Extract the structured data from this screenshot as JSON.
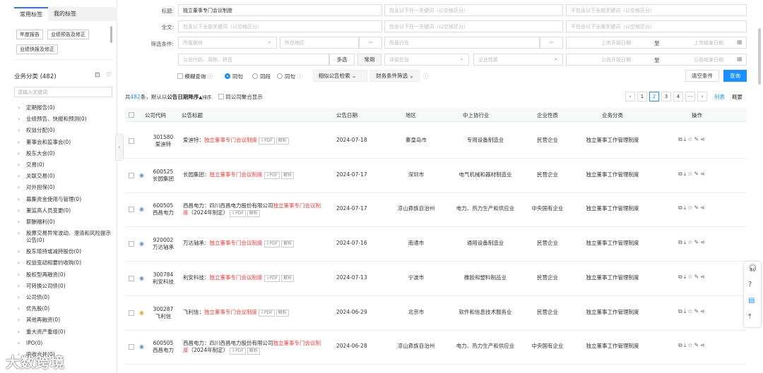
{
  "sidebar": {
    "tabs": [
      "常用标签",
      "我的标签"
    ],
    "chips": [
      "年度报告",
      "业绩预告及修正",
      "业绩快报及修正"
    ],
    "category_title": "业务分类 (482)",
    "keyword_placeholder": "请输入关键词",
    "tree": [
      "定期报告(0)",
      "业绩预告、快报和预测(0)",
      "权益分配(0)",
      "董事会和监事会(0)",
      "股东大会(0)",
      "交易(0)",
      "关联交易(0)",
      "对外担保(0)",
      "募集资金使用与管理(0)",
      "董监高人员变更(0)",
      "薪酬福利(0)",
      "股票交易异常波动、澄清和风险提示公告(0)",
      "股东增持或减持股份(0)",
      "权益变动和要约收购(0)",
      "股权型再融资(0)",
      "可转换公司债(0)",
      "公司债(0)",
      "优先股(0)",
      "其他再融资(0)",
      "重大资产重组(0)",
      "IPO(0)",
      "吸收合并(0)"
    ]
  },
  "filters": {
    "title_label": "标题:",
    "title_value": "独立董事专门会议制度",
    "title_any_ph": "包含以下任一关键词（以空格区分）",
    "title_none_ph": "不包含以下全部关键词（以空格区分）",
    "full_label": "全文:",
    "full_all_ph": "包含以下全部关键词（以空格区分）",
    "full_any_ph": "包含以下任一关键词（以空格区分）",
    "full_none_ph": "不包含以下全部关键词（以空格区分）",
    "cond_label": "筛选条件:",
    "market_ph": "所属板块",
    "region_ph": "所在地区",
    "industry_ph": "所属行业",
    "list_start_ph": "上市开始日期",
    "list_end_ph": "上市结束日期",
    "to": "至",
    "code_ph": "公司代码、简称、拼音",
    "multi_btn": "多选",
    "common_btn": "常用",
    "rating_ph": "评级信息",
    "nature_ph": "企业性质",
    "ann_start_ph": "公告开始日期",
    "ann_end_ph": "公告结束日期",
    "fuzzy": "模糊查询",
    "same_sentence": "同句",
    "same_para": "同段",
    "same_article": "同句",
    "similar_search": "相似公告检索",
    "finance_filter": "财务条件筛选",
    "clear_btn": "清空条件",
    "search_btn": "查询"
  },
  "summary": {
    "prefix": "共",
    "count": "482",
    "suffix": "条，默认以",
    "sort": "公告日期降序",
    "sort_icon": "▲排序",
    "merge": "同公司聚合显示"
  },
  "pager": [
    "‹",
    "1",
    "2",
    "3",
    "4",
    "···",
    "›"
  ],
  "view": {
    "list": "列表",
    "summary": "概要"
  },
  "columns": [
    "公司代码",
    "公告标题",
    "公告日期",
    "地区",
    "中上协行业",
    "企业性质",
    "业务分类",
    "操作"
  ],
  "rows": [
    {
      "code": "301580",
      "short": "爱迪特",
      "company": "爱迪特：",
      "title_red": "独立董事专门会议制度",
      "date": "2024-07-18",
      "region": "秦皇岛市",
      "industry": "专用设备制造业",
      "nature": "民营企业",
      "cat": "独立董事工作管理制度"
    },
    {
      "code": "600525",
      "short": "长园集团",
      "company": "长园集团：",
      "title_red": "独立董事专门会议制度",
      "date": "2024-07-17",
      "region": "深圳市",
      "industry": "电气机械和器材制造业",
      "nature": "民营企业",
      "cat": "独立董事工作管理制度"
    },
    {
      "code": "600505",
      "short": "西昌电力",
      "company": "西昌电力：四川西昌电力股份有限公司",
      "title_red": "独立董事专门会议制度",
      "extra": "（2024年制定）",
      "date": "2024-07-17",
      "region": "凉山彝族自治州",
      "industry": "电力、热力生产和供应业",
      "nature": "中央国有企业",
      "cat": "独立董事工作管理制度"
    },
    {
      "code": "920002",
      "short": "万达轴承",
      "company": "万达轴承：",
      "title_red": "独立董事专门会议制度",
      "date": "2024-07-16",
      "region": "南通市",
      "industry": "通用设备制造业",
      "nature": "民营企业",
      "cat": "独立董事工作管理制度"
    },
    {
      "code": "300784",
      "short": "利安科技",
      "company": "利安科技：",
      "title_red": "独立董事专门会议制度",
      "date": "2024-07-13",
      "region": "宁波市",
      "industry": "橡胶和塑料制品业",
      "nature": "民营企业",
      "cat": "独立董事工作管理制度"
    },
    {
      "code": "300287",
      "short": "飞利信",
      "company": "飞利信：",
      "title_red": "独立董事专门会议制度",
      "date": "2024-06-29",
      "region": "北京市",
      "industry": "软件和信息技术服务业",
      "nature": "民营企业",
      "cat": "独立董事工作管理制度"
    },
    {
      "code": "600505",
      "short": "西昌电力",
      "company": "西昌电力：四川西昌电力股份有限公司",
      "title_red": "独立董事专门会议制度",
      "extra": "（2024年制定）",
      "date": "2024-06-28",
      "region": "凉山彝族自治州",
      "industry": "电力、热力生产和供应业",
      "nature": "中央国有企业",
      "cat": "独立董事工作管理制度"
    }
  ],
  "tags": {
    "pdf": "PDF",
    "parse": "解析"
  },
  "watermark": "大数跨境"
}
